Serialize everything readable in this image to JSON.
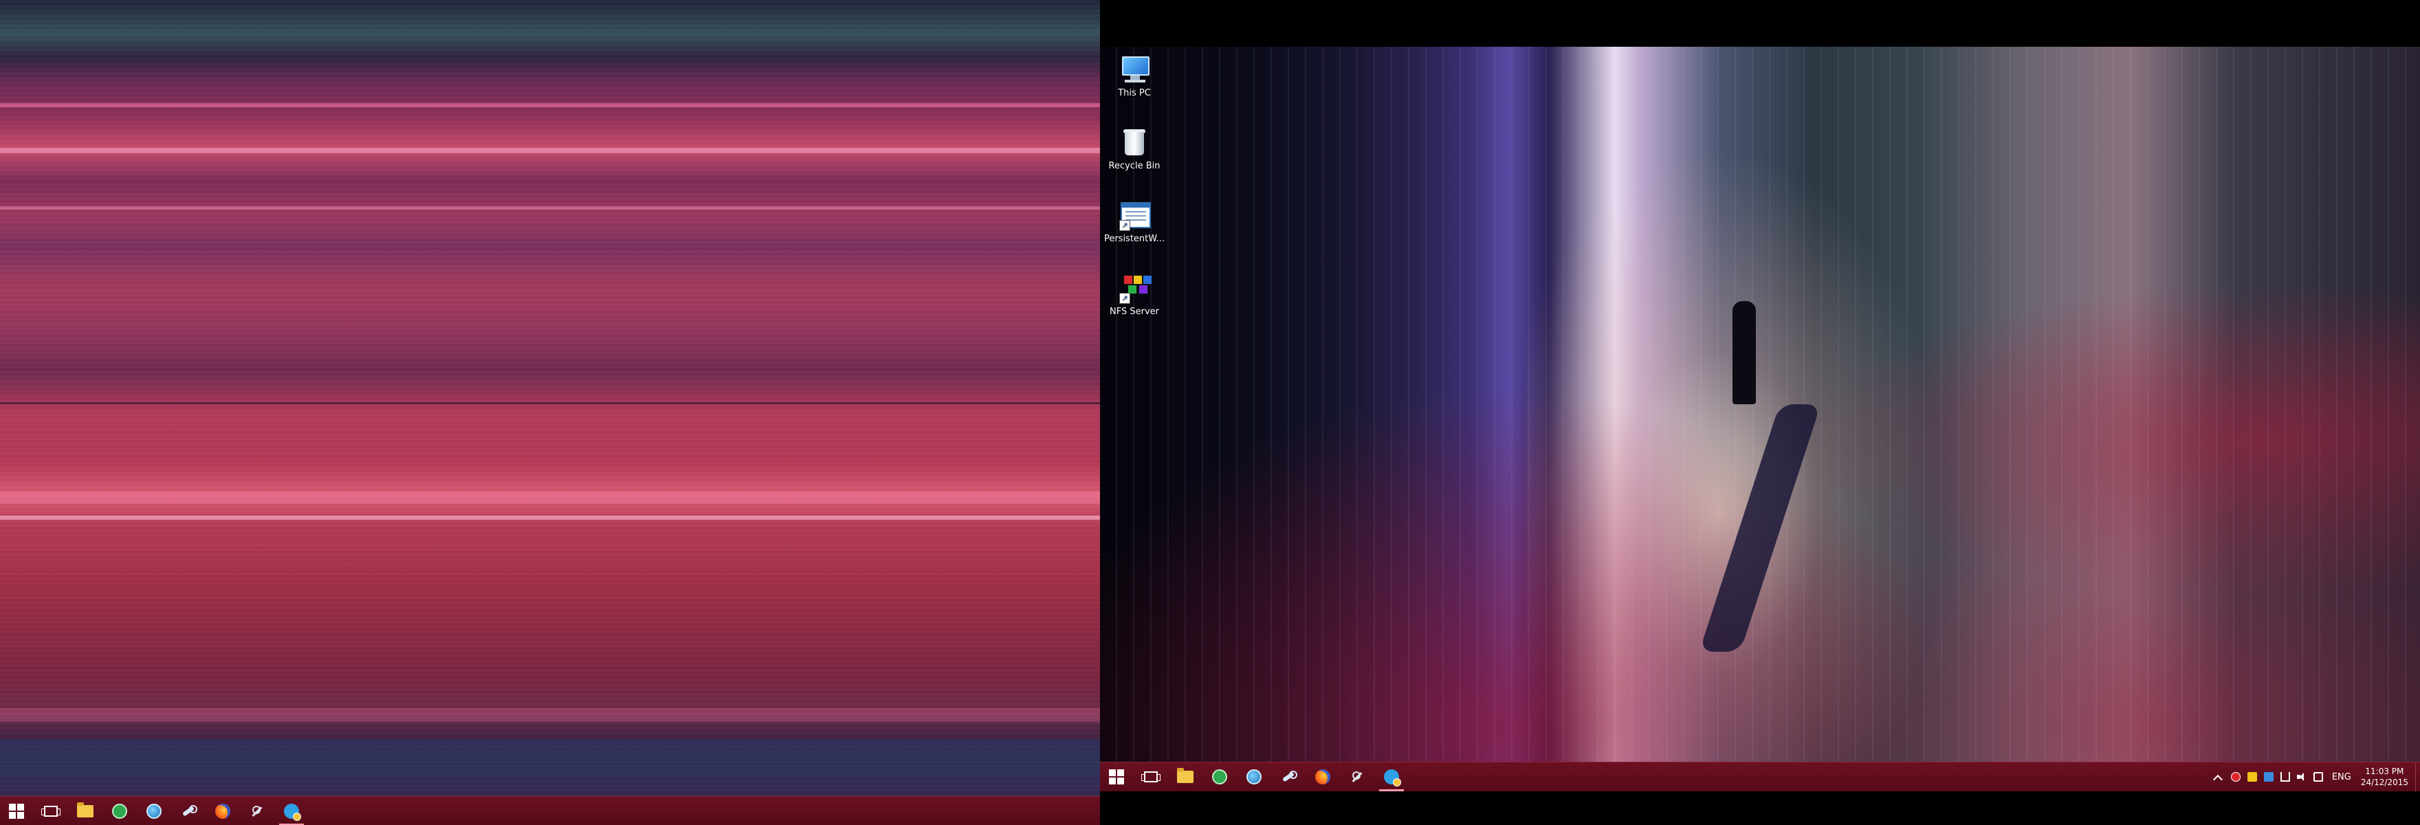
{
  "desktop_icons": [
    {
      "label": "This PC",
      "icon": "computer-icon"
    },
    {
      "label": "Recycle Bin",
      "icon": "recycle-bin-icon"
    },
    {
      "label": "PersistentW...",
      "icon": "document-window-icon"
    },
    {
      "label": "NFS Server",
      "icon": "nfs-server-icon"
    }
  ],
  "taskbar": {
    "pinned": [
      {
        "name": "Start",
        "icon": "windows-logo-icon"
      },
      {
        "name": "Task View",
        "icon": "task-view-icon"
      },
      {
        "name": "File Explorer",
        "icon": "folder-icon"
      },
      {
        "name": "Green circle app",
        "icon": "green-circle-icon"
      },
      {
        "name": "Blue circle app",
        "icon": "blue-circle-icon"
      },
      {
        "name": "Steam",
        "icon": "steam-icon"
      },
      {
        "name": "Firefox",
        "icon": "firefox-icon"
      },
      {
        "name": "Tool",
        "icon": "wrench-tool-icon"
      },
      {
        "name": "Chat app",
        "icon": "chat-app-icon"
      }
    ],
    "language": "ENG",
    "clock_time": "11:03 PM",
    "clock_date": "24/12/2015"
  },
  "colors": {
    "taskbar": "#5e0c1c",
    "accent_underline": "#ff9bb0"
  }
}
